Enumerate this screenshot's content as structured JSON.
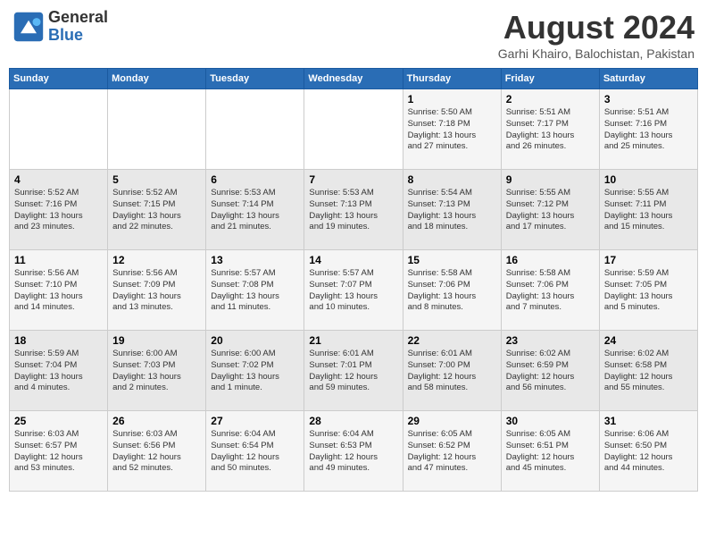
{
  "header": {
    "logo": {
      "line1": "General",
      "line2": "Blue"
    },
    "title": "August 2024",
    "location": "Garhi Khairo, Balochistan, Pakistan"
  },
  "weekdays": [
    "Sunday",
    "Monday",
    "Tuesday",
    "Wednesday",
    "Thursday",
    "Friday",
    "Saturday"
  ],
  "weeks": [
    [
      {
        "day": "",
        "info": ""
      },
      {
        "day": "",
        "info": ""
      },
      {
        "day": "",
        "info": ""
      },
      {
        "day": "",
        "info": ""
      },
      {
        "day": "1",
        "info": "Sunrise: 5:50 AM\nSunset: 7:18 PM\nDaylight: 13 hours\nand 27 minutes."
      },
      {
        "day": "2",
        "info": "Sunrise: 5:51 AM\nSunset: 7:17 PM\nDaylight: 13 hours\nand 26 minutes."
      },
      {
        "day": "3",
        "info": "Sunrise: 5:51 AM\nSunset: 7:16 PM\nDaylight: 13 hours\nand 25 minutes."
      }
    ],
    [
      {
        "day": "4",
        "info": "Sunrise: 5:52 AM\nSunset: 7:16 PM\nDaylight: 13 hours\nand 23 minutes."
      },
      {
        "day": "5",
        "info": "Sunrise: 5:52 AM\nSunset: 7:15 PM\nDaylight: 13 hours\nand 22 minutes."
      },
      {
        "day": "6",
        "info": "Sunrise: 5:53 AM\nSunset: 7:14 PM\nDaylight: 13 hours\nand 21 minutes."
      },
      {
        "day": "7",
        "info": "Sunrise: 5:53 AM\nSunset: 7:13 PM\nDaylight: 13 hours\nand 19 minutes."
      },
      {
        "day": "8",
        "info": "Sunrise: 5:54 AM\nSunset: 7:13 PM\nDaylight: 13 hours\nand 18 minutes."
      },
      {
        "day": "9",
        "info": "Sunrise: 5:55 AM\nSunset: 7:12 PM\nDaylight: 13 hours\nand 17 minutes."
      },
      {
        "day": "10",
        "info": "Sunrise: 5:55 AM\nSunset: 7:11 PM\nDaylight: 13 hours\nand 15 minutes."
      }
    ],
    [
      {
        "day": "11",
        "info": "Sunrise: 5:56 AM\nSunset: 7:10 PM\nDaylight: 13 hours\nand 14 minutes."
      },
      {
        "day": "12",
        "info": "Sunrise: 5:56 AM\nSunset: 7:09 PM\nDaylight: 13 hours\nand 13 minutes."
      },
      {
        "day": "13",
        "info": "Sunrise: 5:57 AM\nSunset: 7:08 PM\nDaylight: 13 hours\nand 11 minutes."
      },
      {
        "day": "14",
        "info": "Sunrise: 5:57 AM\nSunset: 7:07 PM\nDaylight: 13 hours\nand 10 minutes."
      },
      {
        "day": "15",
        "info": "Sunrise: 5:58 AM\nSunset: 7:06 PM\nDaylight: 13 hours\nand 8 minutes."
      },
      {
        "day": "16",
        "info": "Sunrise: 5:58 AM\nSunset: 7:06 PM\nDaylight: 13 hours\nand 7 minutes."
      },
      {
        "day": "17",
        "info": "Sunrise: 5:59 AM\nSunset: 7:05 PM\nDaylight: 13 hours\nand 5 minutes."
      }
    ],
    [
      {
        "day": "18",
        "info": "Sunrise: 5:59 AM\nSunset: 7:04 PM\nDaylight: 13 hours\nand 4 minutes."
      },
      {
        "day": "19",
        "info": "Sunrise: 6:00 AM\nSunset: 7:03 PM\nDaylight: 13 hours\nand 2 minutes."
      },
      {
        "day": "20",
        "info": "Sunrise: 6:00 AM\nSunset: 7:02 PM\nDaylight: 13 hours\nand 1 minute."
      },
      {
        "day": "21",
        "info": "Sunrise: 6:01 AM\nSunset: 7:01 PM\nDaylight: 12 hours\nand 59 minutes."
      },
      {
        "day": "22",
        "info": "Sunrise: 6:01 AM\nSunset: 7:00 PM\nDaylight: 12 hours\nand 58 minutes."
      },
      {
        "day": "23",
        "info": "Sunrise: 6:02 AM\nSunset: 6:59 PM\nDaylight: 12 hours\nand 56 minutes."
      },
      {
        "day": "24",
        "info": "Sunrise: 6:02 AM\nSunset: 6:58 PM\nDaylight: 12 hours\nand 55 minutes."
      }
    ],
    [
      {
        "day": "25",
        "info": "Sunrise: 6:03 AM\nSunset: 6:57 PM\nDaylight: 12 hours\nand 53 minutes."
      },
      {
        "day": "26",
        "info": "Sunrise: 6:03 AM\nSunset: 6:56 PM\nDaylight: 12 hours\nand 52 minutes."
      },
      {
        "day": "27",
        "info": "Sunrise: 6:04 AM\nSunset: 6:54 PM\nDaylight: 12 hours\nand 50 minutes."
      },
      {
        "day": "28",
        "info": "Sunrise: 6:04 AM\nSunset: 6:53 PM\nDaylight: 12 hours\nand 49 minutes."
      },
      {
        "day": "29",
        "info": "Sunrise: 6:05 AM\nSunset: 6:52 PM\nDaylight: 12 hours\nand 47 minutes."
      },
      {
        "day": "30",
        "info": "Sunrise: 6:05 AM\nSunset: 6:51 PM\nDaylight: 12 hours\nand 45 minutes."
      },
      {
        "day": "31",
        "info": "Sunrise: 6:06 AM\nSunset: 6:50 PM\nDaylight: 12 hours\nand 44 minutes."
      }
    ]
  ]
}
